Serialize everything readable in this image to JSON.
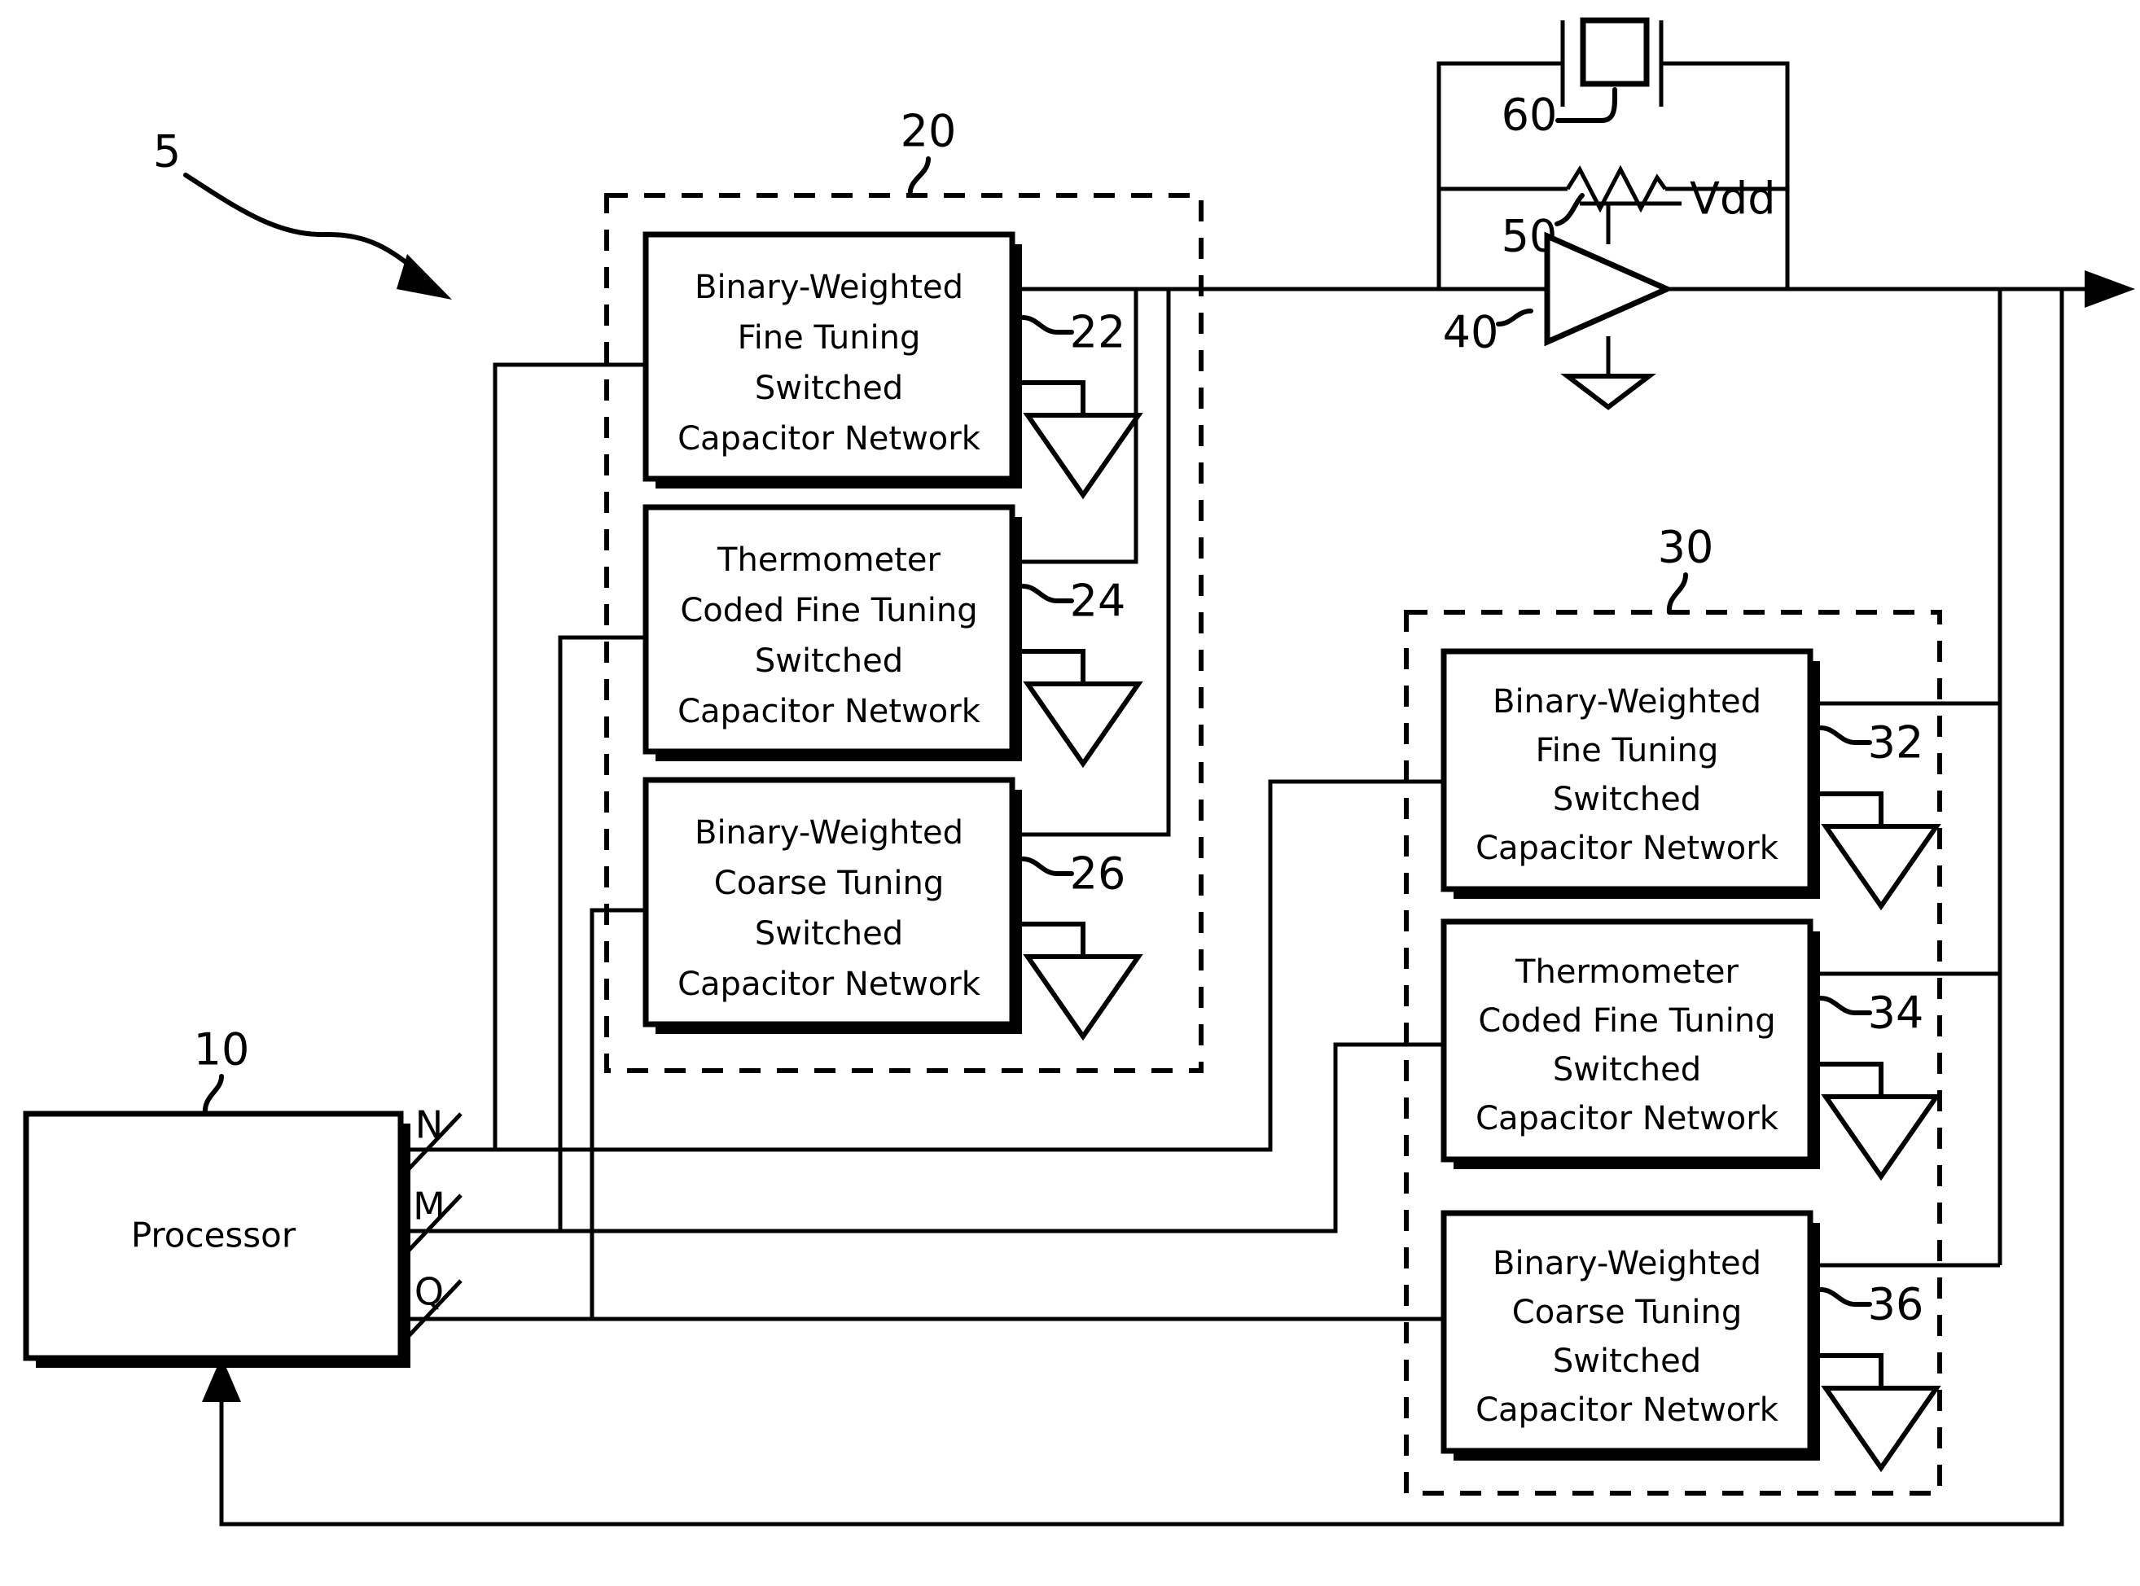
{
  "figure": {
    "label_5": "5",
    "title_hidden": ""
  },
  "processor": {
    "label": "Processor",
    "ref": "10",
    "buses": [
      {
        "name": "N"
      },
      {
        "name": "M"
      },
      {
        "name": "Q"
      }
    ]
  },
  "group_left": {
    "ref": "20",
    "blocks": [
      {
        "ref": "22",
        "lines": [
          "Binary-Weighted",
          "Fine Tuning",
          "Switched",
          "Capacitor Network"
        ]
      },
      {
        "ref": "24",
        "lines": [
          "Thermometer",
          "Coded Fine Tuning",
          "Switched",
          "Capacitor Network"
        ]
      },
      {
        "ref": "26",
        "lines": [
          "Binary-Weighted",
          "Coarse Tuning",
          "Switched",
          "Capacitor Network"
        ]
      }
    ]
  },
  "group_right": {
    "ref": "30",
    "blocks": [
      {
        "ref": "32",
        "lines": [
          "Binary-Weighted",
          "Fine Tuning",
          "Switched",
          "Capacitor Network"
        ]
      },
      {
        "ref": "34",
        "lines": [
          "Thermometer",
          "Coded Fine Tuning",
          "Switched",
          "Capacitor Network"
        ]
      },
      {
        "ref": "36",
        "lines": [
          "Binary-Weighted",
          "Coarse Tuning",
          "Switched",
          "Capacitor Network"
        ]
      }
    ]
  },
  "oscillator": {
    "crystal_ref": "60",
    "resistor_ref": "50",
    "amplifier_ref": "40",
    "supply_label": "Vdd"
  },
  "colors": {
    "ink": "#000000",
    "paper": "#ffffff"
  }
}
